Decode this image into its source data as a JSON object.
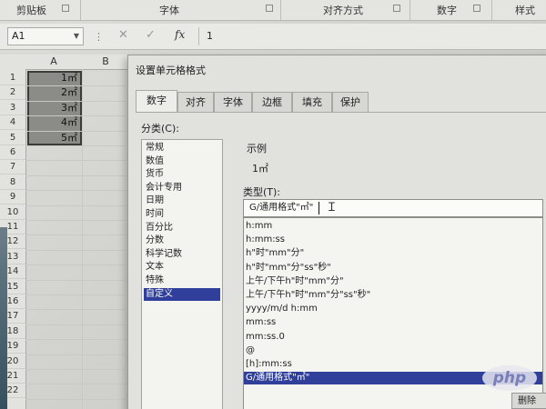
{
  "ribbon": {
    "clipboard": "剪贴板",
    "font": "字体",
    "alignment": "对齐方式",
    "number": "数字",
    "styles": "样式"
  },
  "formula_bar": {
    "name_box": "A1",
    "fx": "fx",
    "content": "1"
  },
  "sheet": {
    "col_a": "A",
    "col_b": "B",
    "rows": [
      "1",
      "2",
      "3",
      "4",
      "5",
      "6",
      "7",
      "8",
      "9",
      "10",
      "11",
      "12",
      "13",
      "14",
      "15",
      "16",
      "17",
      "18",
      "19",
      "20",
      "21",
      "22"
    ],
    "cells": [
      "1㎡",
      "2㎡",
      "3㎡",
      "4㎡",
      "5㎡"
    ]
  },
  "dialog": {
    "title": "设置单元格格式",
    "tabs": [
      "数字",
      "对齐",
      "字体",
      "边框",
      "填充",
      "保护"
    ],
    "category_label": "分类(C):",
    "categories": [
      "常规",
      "数值",
      "货币",
      "会计专用",
      "日期",
      "时间",
      "百分比",
      "分数",
      "科学记数",
      "文本",
      "特殊",
      "自定义"
    ],
    "selected_category": "自定义",
    "sample_label": "示例",
    "sample_value": "1㎡",
    "type_label": "类型(T):",
    "type_input": "G/通用格式\"㎡\"",
    "type_list": [
      "h:mm",
      "h:mm:ss",
      "h\"时\"mm\"分\"",
      "h\"时\"mm\"分\"ss\"秒\"",
      "上午/下午h\"时\"mm\"分\"",
      "上午/下午h\"时\"mm\"分\"ss\"秒\"",
      "yyyy/m/d h:mm",
      "mm:ss",
      "mm:ss.0",
      "@",
      "[h]:mm:ss",
      "G/通用格式\"㎡\""
    ],
    "delete_button": "删除"
  },
  "watermark": "php"
}
